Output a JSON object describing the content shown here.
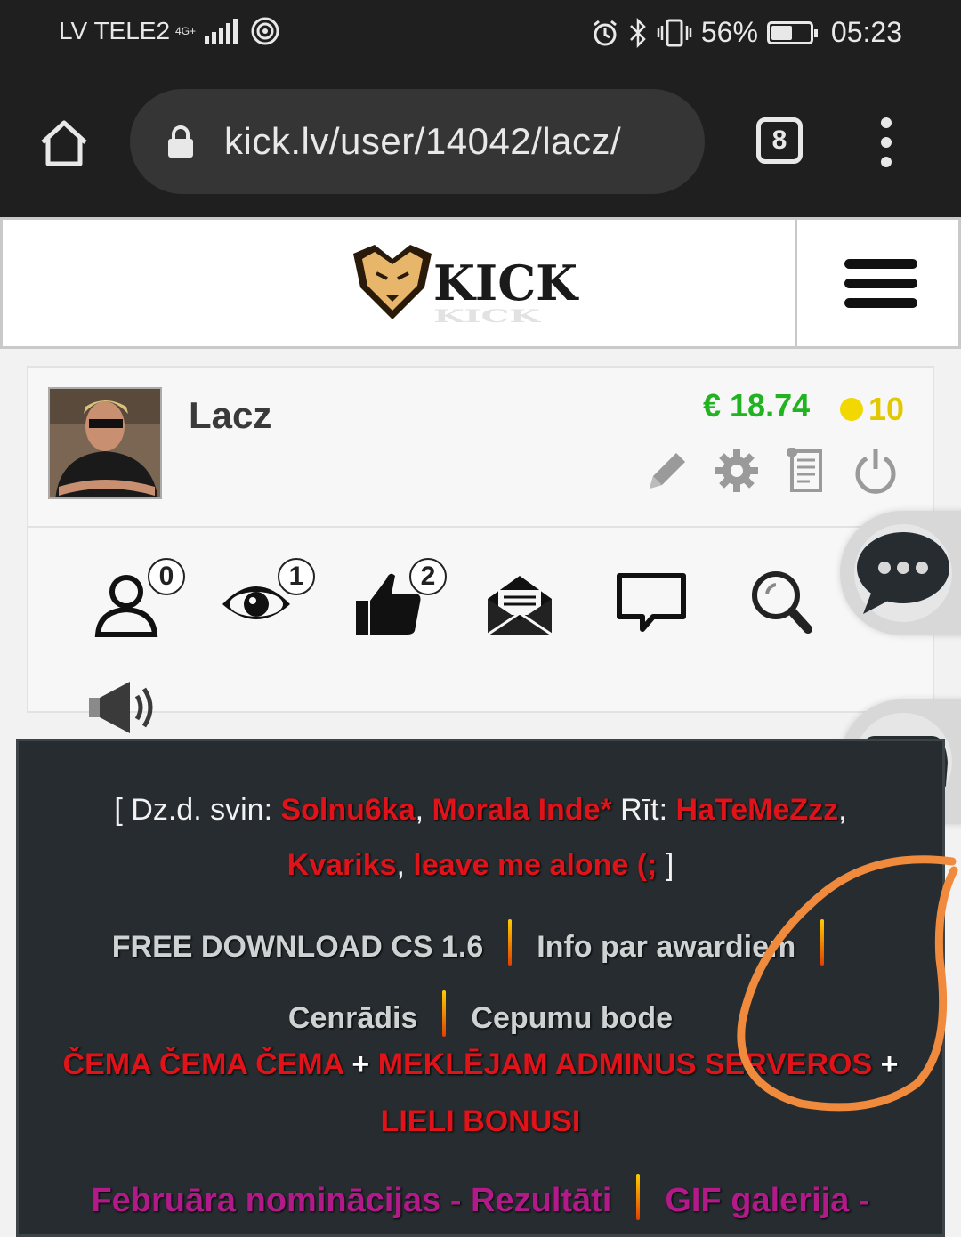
{
  "status_bar": {
    "carrier": "LV TELE2",
    "network": "4G+",
    "battery_percent": "56%",
    "battery_level": 0.56,
    "time": "05:23"
  },
  "browser": {
    "url": "kick.lv/user/14042/lacz/",
    "tab_count": "8"
  },
  "site": {
    "logo_text": "KICK"
  },
  "profile": {
    "username": "Lacz",
    "balance": "€ 18.74",
    "points": "10",
    "badges": {
      "friends": "0",
      "views": "1",
      "likes": "2"
    }
  },
  "notice": {
    "birthdays_prefix": "[ Dz.d. svin: ",
    "birthday_today_1": "Solnu6ka",
    "birthday_today_2": "Morala Inde*",
    "tomorrow_label": " Rīt: ",
    "birthday_tomorrow_1": "HaTeMeZzz",
    "birthday_tomorrow_2": "Kvariks",
    "birthday_tomorrow_3": "leave me alone (;",
    "birthdays_suffix": " ]",
    "nav_links": [
      "FREE DOWNLOAD CS 1.6",
      "Info par awardiem",
      "Cenrādis",
      "Cepumu bode"
    ],
    "red_links": [
      "ČEMA ČEMA ČEMA",
      "MEKLĒJAM ADMINUS SERVEROS",
      "LIELI BONUSI"
    ],
    "pink_links": [
      "Februāra nominācijas - Rezultāti",
      "GIF galerija -"
    ]
  }
}
